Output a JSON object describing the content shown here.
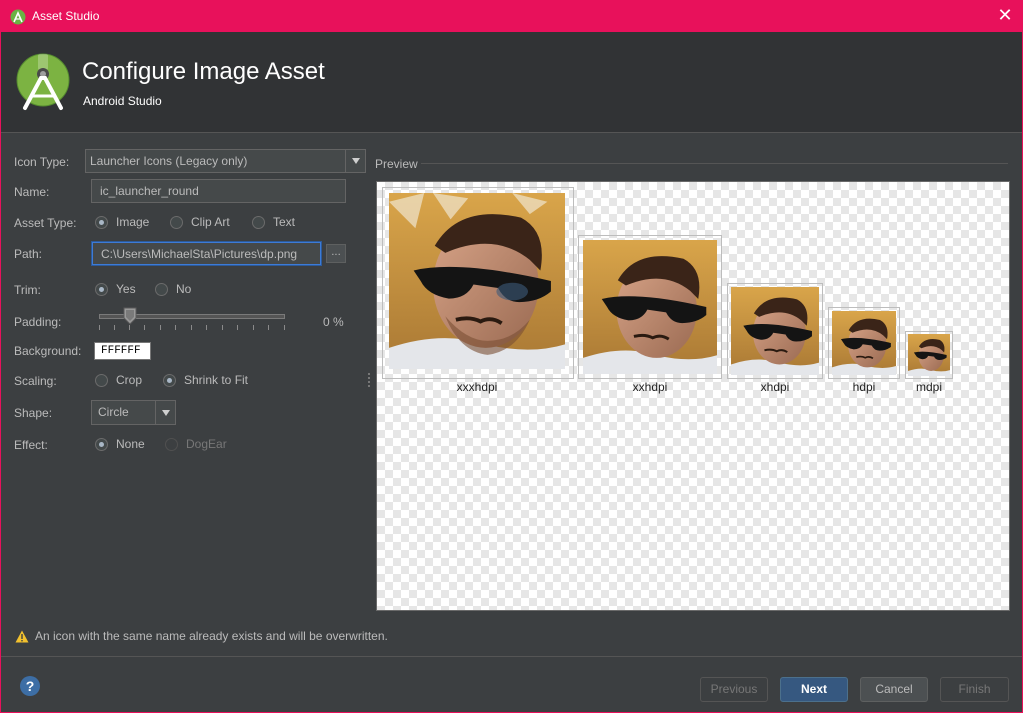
{
  "window": {
    "title": "Asset Studio",
    "close_glyph": "✕",
    "border_color": "#e8115b"
  },
  "header": {
    "title": "Configure Image Asset",
    "subtitle": "Android Studio",
    "logo_icon": "android-studio-icon"
  },
  "form": {
    "icon_type": {
      "label": "Icon Type:",
      "value": "Launcher Icons (Legacy only)"
    },
    "name": {
      "label": "Name:",
      "value": "ic_launcher_round"
    },
    "asset_type": {
      "label": "Asset Type:",
      "options": [
        "Image",
        "Clip Art",
        "Text"
      ],
      "selected": "Image"
    },
    "path": {
      "label": "Path:",
      "value": "C:\\Users\\MichaelSta\\Pictures\\dp.png",
      "browse_label": "..."
    },
    "trim": {
      "label": "Trim:",
      "options": [
        "Yes",
        "No"
      ],
      "selected": "Yes"
    },
    "padding": {
      "label": "Padding:",
      "value_text": "0 %",
      "value": 0
    },
    "background": {
      "label": "Background:",
      "value": "FFFFFF"
    },
    "scaling": {
      "label": "Scaling:",
      "options": [
        "Crop",
        "Shrink to Fit"
      ],
      "selected": "Shrink to Fit"
    },
    "shape": {
      "label": "Shape:",
      "value": "Circle"
    },
    "effect": {
      "label": "Effect:",
      "options": [
        "None",
        "DogEar"
      ],
      "selected": "None",
      "disabled": [
        "DogEar"
      ]
    }
  },
  "preview": {
    "title": "Preview",
    "icons": [
      {
        "label": "xxxhdpi"
      },
      {
        "label": "xxhdpi"
      },
      {
        "label": "xhdpi"
      },
      {
        "label": "hdpi"
      },
      {
        "label": "mdpi"
      }
    ]
  },
  "warning": {
    "icon": "warning-icon",
    "text": "An icon with the same name already exists and will be overwritten."
  },
  "footer": {
    "help_icon": "help-icon",
    "previous": "Previous",
    "next": "Next",
    "cancel": "Cancel",
    "finish": "Finish"
  }
}
